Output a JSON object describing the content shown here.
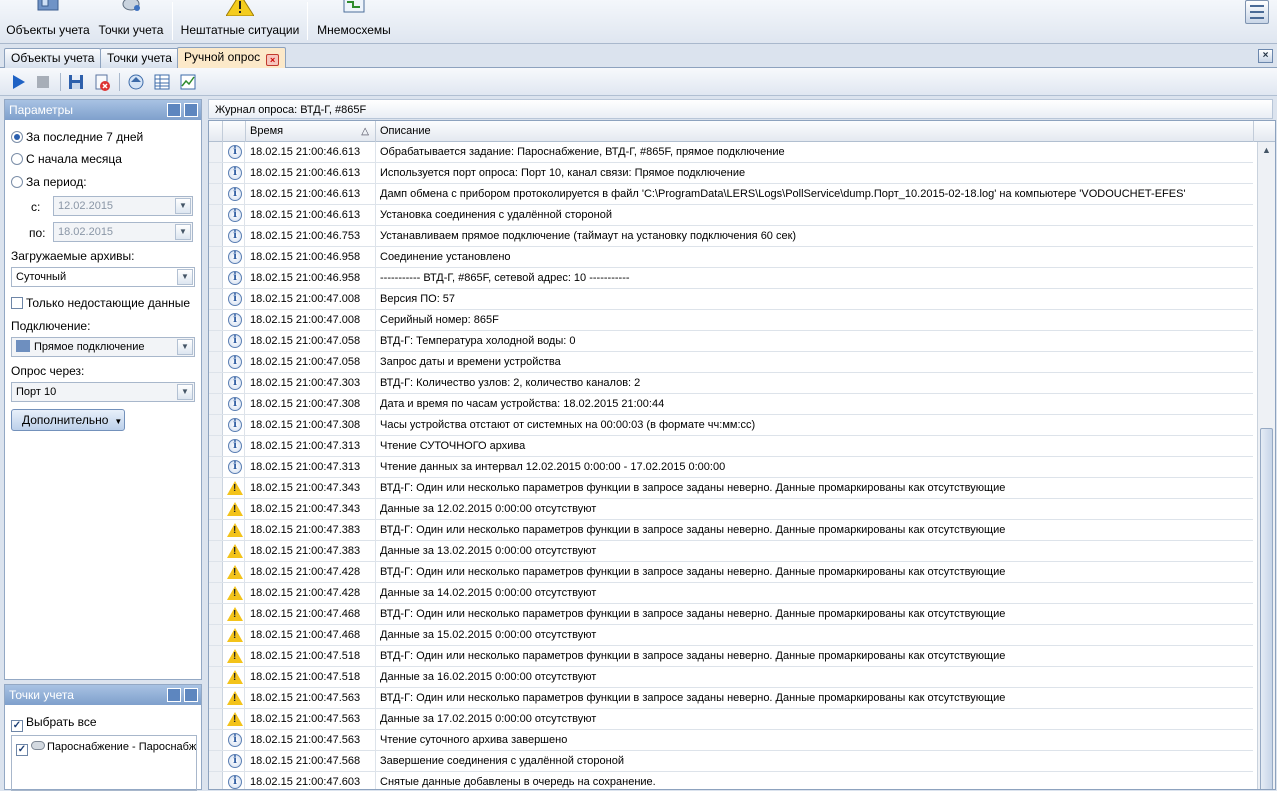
{
  "ribbon": {
    "buttons": [
      {
        "label": "Объекты учета",
        "icon": "objects-icon"
      },
      {
        "label": "Точки учета",
        "icon": "points-icon"
      },
      {
        "label": "Нештатные ситуации",
        "icon": "warning-icon"
      },
      {
        "label": "Мнемосхемы",
        "icon": "mnemo-icon"
      }
    ]
  },
  "tabs": [
    {
      "label": "Объекты учета"
    },
    {
      "label": "Точки учета"
    },
    {
      "label": "Ручной опрос",
      "active": true
    }
  ],
  "params": {
    "title": "Параметры",
    "radio_last7": "За последние 7 дней",
    "radio_month": "С начала месяца",
    "radio_period": "За период:",
    "from_label": "с:",
    "from_value": "12.02.2015",
    "to_label": "по:",
    "to_value": "18.02.2015",
    "archives_label": "Загружаемые архивы:",
    "archives_value": "Суточный",
    "only_missing": "Только недостающие данные",
    "connection_label": "Подключение:",
    "connection_value": "Прямое подключение",
    "poll_via_label": "Опрос через:",
    "poll_via_value": "Порт 10",
    "advanced_button": "Дополнительно"
  },
  "points": {
    "title": "Точки учета",
    "select_all": "Выбрать все",
    "item": "Пароснабжение - Пароснабж"
  },
  "journal": {
    "title": "Журнал опроса: ВТД-Г, #865F",
    "col_time": "Время",
    "col_desc": "Описание",
    "rows": [
      {
        "type": "info",
        "time": "18.02.15 21:00:46.613",
        "desc": "Обрабатывается задание: Пароснабжение, ВТД-Г, #865F, прямое подключение"
      },
      {
        "type": "info",
        "time": "18.02.15 21:00:46.613",
        "desc": "Используется порт опроса: Порт 10, канал связи: Прямое подключение"
      },
      {
        "type": "info",
        "time": "18.02.15 21:00:46.613",
        "desc": "Дамп обмена с прибором протоколируется в файл 'C:\\ProgramData\\LERS\\Logs\\PollService\\dump.Порт_10.2015-02-18.log' на компьютере 'VODOUCHET-EFES'"
      },
      {
        "type": "info",
        "time": "18.02.15 21:00:46.613",
        "desc": "Установка соединения с удалённой стороной"
      },
      {
        "type": "info",
        "time": "18.02.15 21:00:46.753",
        "desc": "Устанавливаем прямое подключение (таймаут на установку подключения 60 сек)"
      },
      {
        "type": "info",
        "time": "18.02.15 21:00:46.958",
        "desc": "Соединение установлено"
      },
      {
        "type": "info",
        "time": "18.02.15 21:00:46.958",
        "desc": "----------- ВТД-Г, #865F, сетевой адрес: 10 -----------"
      },
      {
        "type": "info",
        "time": "18.02.15 21:00:47.008",
        "desc": "Версия ПО: 57"
      },
      {
        "type": "info",
        "time": "18.02.15 21:00:47.008",
        "desc": "Серийный номер: 865F"
      },
      {
        "type": "info",
        "time": "18.02.15 21:00:47.058",
        "desc": "ВТД-Г: Температура холодной воды: 0"
      },
      {
        "type": "info",
        "time": "18.02.15 21:00:47.058",
        "desc": "Запрос даты и времени устройства"
      },
      {
        "type": "info",
        "time": "18.02.15 21:00:47.303",
        "desc": "ВТД-Г: Количество узлов: 2, количество каналов: 2"
      },
      {
        "type": "info",
        "time": "18.02.15 21:00:47.308",
        "desc": "Дата и время по часам устройства: 18.02.2015 21:00:44"
      },
      {
        "type": "info",
        "time": "18.02.15 21:00:47.308",
        "desc": "Часы устройства отстают от системных на 00:00:03 (в формате чч:мм:сс)"
      },
      {
        "type": "info",
        "time": "18.02.15 21:00:47.313",
        "desc": "Чтение СУТОЧНОГО архива"
      },
      {
        "type": "info",
        "time": "18.02.15 21:00:47.313",
        "desc": "Чтение данных за интервал 12.02.2015 0:00:00 - 17.02.2015 0:00:00"
      },
      {
        "type": "warn",
        "time": "18.02.15 21:00:47.343",
        "desc": "ВТД-Г: Один или несколько параметров функции в запросе заданы неверно. Данные промаркированы как отсутствующие"
      },
      {
        "type": "warn",
        "time": "18.02.15 21:00:47.343",
        "desc": "Данные за 12.02.2015 0:00:00 отсутствуют"
      },
      {
        "type": "warn",
        "time": "18.02.15 21:00:47.383",
        "desc": "ВТД-Г: Один или несколько параметров функции в запросе заданы неверно. Данные промаркированы как отсутствующие"
      },
      {
        "type": "warn",
        "time": "18.02.15 21:00:47.383",
        "desc": "Данные за 13.02.2015 0:00:00 отсутствуют"
      },
      {
        "type": "warn",
        "time": "18.02.15 21:00:47.428",
        "desc": "ВТД-Г: Один или несколько параметров функции в запросе заданы неверно. Данные промаркированы как отсутствующие"
      },
      {
        "type": "warn",
        "time": "18.02.15 21:00:47.428",
        "desc": "Данные за 14.02.2015 0:00:00 отсутствуют"
      },
      {
        "type": "warn",
        "time": "18.02.15 21:00:47.468",
        "desc": "ВТД-Г: Один или несколько параметров функции в запросе заданы неверно. Данные промаркированы как отсутствующие"
      },
      {
        "type": "warn",
        "time": "18.02.15 21:00:47.468",
        "desc": "Данные за 15.02.2015 0:00:00 отсутствуют"
      },
      {
        "type": "warn",
        "time": "18.02.15 21:00:47.518",
        "desc": "ВТД-Г: Один или несколько параметров функции в запросе заданы неверно. Данные промаркированы как отсутствующие"
      },
      {
        "type": "warn",
        "time": "18.02.15 21:00:47.518",
        "desc": "Данные за 16.02.2015 0:00:00 отсутствуют"
      },
      {
        "type": "warn",
        "time": "18.02.15 21:00:47.563",
        "desc": "ВТД-Г: Один или несколько параметров функции в запросе заданы неверно. Данные промаркированы как отсутствующие"
      },
      {
        "type": "warn",
        "time": "18.02.15 21:00:47.563",
        "desc": "Данные за 17.02.2015 0:00:00 отсутствуют"
      },
      {
        "type": "info",
        "time": "18.02.15 21:00:47.563",
        "desc": "Чтение суточного архива завершено"
      },
      {
        "type": "info",
        "time": "18.02.15 21:00:47.568",
        "desc": "Завершение соединения с удалённой стороной"
      },
      {
        "type": "info",
        "time": "18.02.15 21:00:47.603",
        "desc": "Снятые данные добавлены в очередь на сохранение."
      }
    ]
  }
}
